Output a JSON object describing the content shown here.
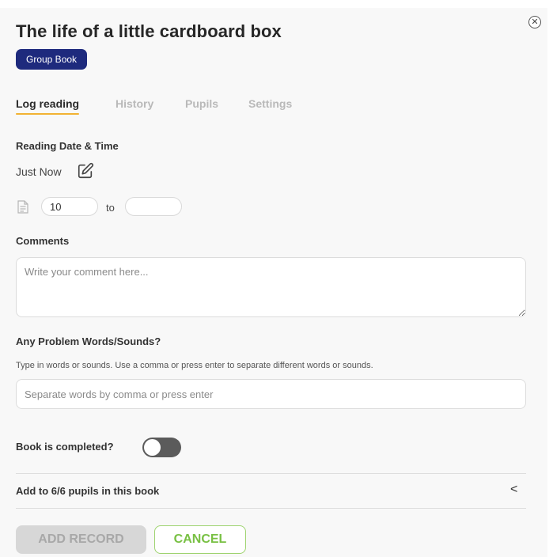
{
  "header": {
    "title": "The life of a little cardboard box",
    "badge": "Group Book",
    "close_icon": "close-circle-icon"
  },
  "tabs": [
    {
      "label": "Log reading",
      "active": true
    },
    {
      "label": "History",
      "active": false
    },
    {
      "label": "Pupils",
      "active": false
    },
    {
      "label": "Settings",
      "active": false
    }
  ],
  "reading": {
    "section_label": "Reading Date & Time",
    "date_value": "Just Now",
    "edit_icon": "edit-pencil-icon",
    "page_icon": "document-icon",
    "page_from": "10",
    "page_to": "",
    "to_label": "to"
  },
  "comments": {
    "label": "Comments",
    "placeholder": "Write your comment here..."
  },
  "problem_words": {
    "label": "Any Problem Words/Sounds?",
    "help": "Type in words or sounds. Use a comma or press enter to separate different words or sounds.",
    "placeholder": "Separate words by comma or press enter"
  },
  "completed": {
    "label": "Book is completed?",
    "checked": false
  },
  "pupils": {
    "label": "Add to 6/6 pupils in this book",
    "chevron": "<"
  },
  "actions": {
    "add_label": "ADD RECORD",
    "cancel_label": "CANCEL"
  },
  "colors": {
    "badge_bg": "#1e2a7d",
    "tab_underline": "#f2b233",
    "cancel_green": "#78c043",
    "toggle_off": "#5b5b5b"
  }
}
